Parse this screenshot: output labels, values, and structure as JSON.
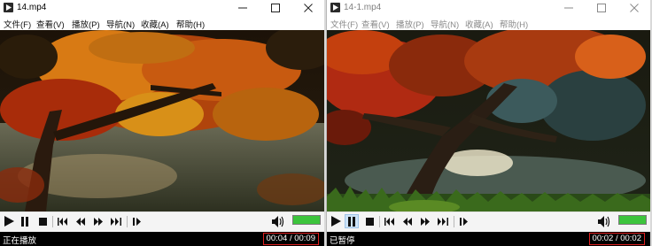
{
  "windows": [
    {
      "title": "14.mp4",
      "menu": [
        "文件(F)",
        "查看(V)",
        "播放(P)",
        "导航(N)",
        "收藏(A)",
        "帮助(H)"
      ],
      "status": "正在播放",
      "time": "00:04 / 00:09",
      "state": "playing",
      "volume_level": 1.0
    },
    {
      "title": "14-1.mp4",
      "menu": [
        "文件(F)",
        "查看(V)",
        "播放(P)",
        "导航(N)",
        "收藏(A)",
        "帮助(H)"
      ],
      "status": "已暂停",
      "time": "00:02 / 00:02",
      "state": "paused",
      "volume_level": 1.0
    }
  ],
  "icons": {
    "app": "media-player-icon",
    "minimize": "minimize-icon",
    "maximize": "maximize-icon",
    "close": "close-icon",
    "controls": [
      "play-icon",
      "pause-icon",
      "stop-icon",
      "skip-back-icon",
      "rewind-icon",
      "fast-forward-icon",
      "skip-forward-icon",
      "frame-step-icon",
      "speaker-icon"
    ]
  },
  "colors": {
    "highlight_box": "#e02020",
    "volume_bar": "#3cc43c",
    "status_bg": "#000000"
  }
}
